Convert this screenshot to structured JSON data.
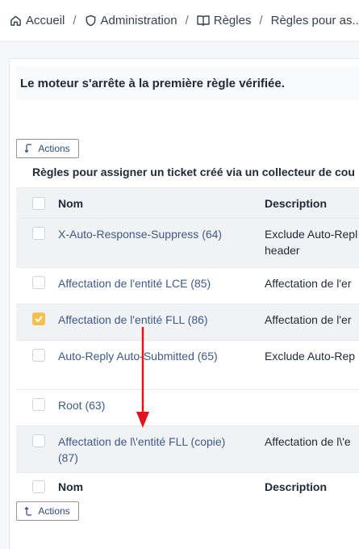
{
  "breadcrumb": {
    "items": [
      {
        "label": "Accueil",
        "icon": "home-icon"
      },
      {
        "label": "Administration",
        "icon": "shield-icon"
      },
      {
        "label": "Règles",
        "icon": "book-icon"
      },
      {
        "label": "Règles pour as...",
        "icon": ""
      }
    ],
    "separator": "/"
  },
  "notice": "Le moteur s'arrête à la première règle vérifiée.",
  "actions_label": "Actions",
  "table": {
    "title": "Règles pour assigner un ticket créé via un collecteur de cou",
    "headers": {
      "name": "Nom",
      "description": "Description"
    },
    "rows": [
      {
        "name": "X-Auto-Response-Suppress (64)",
        "description": "Exclude Auto-Repl",
        "description2": "header",
        "checked": false
      },
      {
        "name": "Affectation de l'entité LCE (85)",
        "description": "Affectation de l'er",
        "checked": false
      },
      {
        "name": "Affectation de l'entité FLL (86)",
        "description": "Affectation de l'er",
        "checked": true
      },
      {
        "name": "Auto-Reply Auto-Submitted (65)",
        "description": "Exclude Auto-Rep",
        "checked": false
      },
      {
        "name": "Root (63)",
        "description": "",
        "checked": false
      },
      {
        "name": "Affectation de l\\'entité FLL (copie)",
        "name2": "(87)",
        "description": "Affectation de l\\'e",
        "checked": false
      }
    ]
  },
  "colors": {
    "accent": "#3d5a8a",
    "checked": "#f4c04e",
    "arrow": "#e0151b"
  }
}
